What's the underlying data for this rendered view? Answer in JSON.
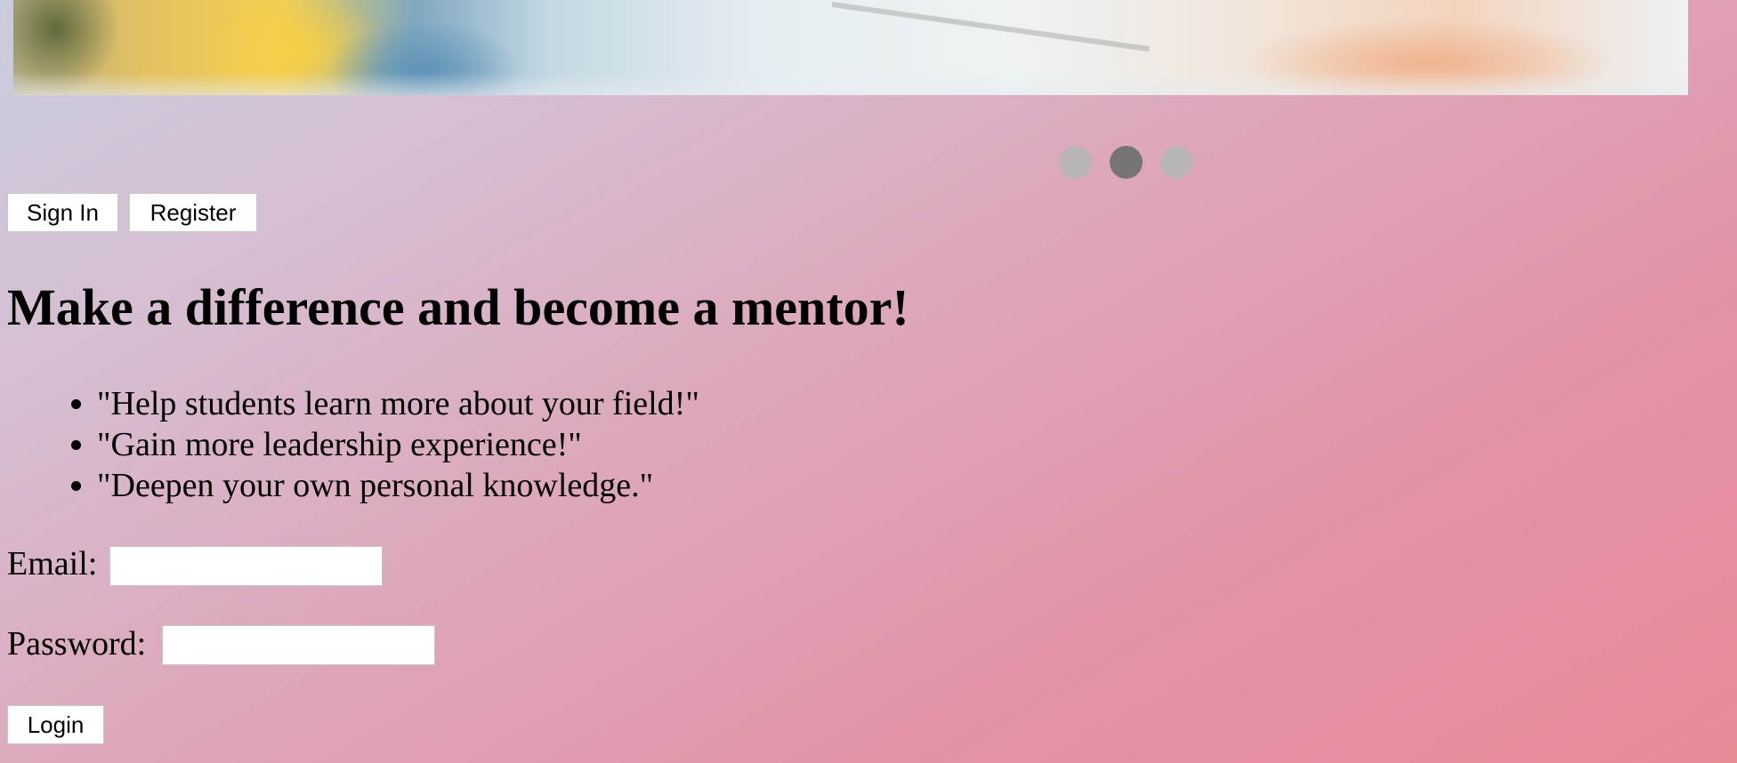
{
  "carousel": {
    "slide_count": 3,
    "active_index": 1
  },
  "nav": {
    "signin_label": "Sign In",
    "register_label": "Register"
  },
  "hero": {
    "title": "Make a difference and become a mentor!"
  },
  "benefits": [
    "\"Help students learn more about your field!\"",
    "\"Gain more leadership experience!\"",
    "\"Deepen your own personal knowledge.\""
  ],
  "form": {
    "email_label": "Email:",
    "email_value": "",
    "password_label": "Password:",
    "password_value": "",
    "login_label": "Login"
  },
  "colors": {
    "gradient_start": "#c9cddf",
    "gradient_end": "#e88a98",
    "dot_inactive": "#b9b4b7",
    "dot_active": "#777477"
  }
}
